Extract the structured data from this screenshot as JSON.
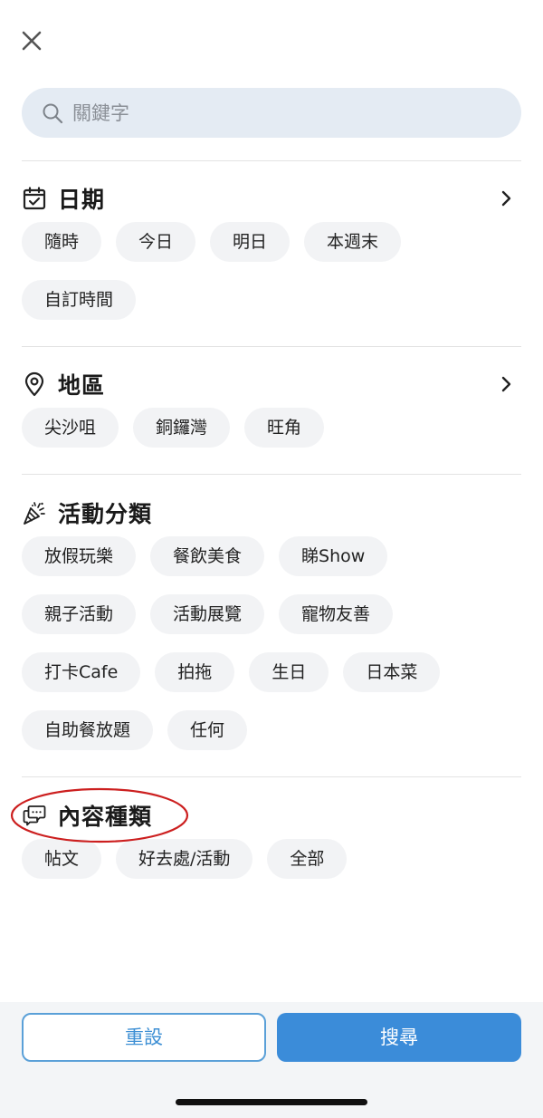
{
  "close": {
    "icon": "close-icon"
  },
  "search": {
    "placeholder": "關鍵字",
    "value": "",
    "icon": "search-icon"
  },
  "sections": {
    "date": {
      "title": "日期",
      "icon": "calendar-check-icon",
      "chips": [
        "隨時",
        "今日",
        "明日",
        "本週末",
        "自訂時間"
      ]
    },
    "area": {
      "title": "地區",
      "icon": "location-pin-icon",
      "chips": [
        "尖沙咀",
        "銅鑼灣",
        "旺角"
      ]
    },
    "category": {
      "title": "活動分類",
      "icon": "party-popper-icon",
      "chips": [
        "放假玩樂",
        "餐飲美食",
        "睇Show",
        "親子活動",
        "活動展覽",
        "寵物友善",
        "打卡Cafe",
        "拍拖",
        "生日",
        "日本菜",
        "自助餐放題",
        "任何"
      ]
    },
    "content_type": {
      "title": "內容種類",
      "icon": "chat-bubbles-icon",
      "chips": [
        "帖文",
        "好去處/活動",
        "全部"
      ]
    }
  },
  "footer": {
    "reset_label": "重設",
    "search_label": "搜尋"
  },
  "colors": {
    "accent": "#3b8cd9",
    "annotation": "#cc1f1f",
    "chip_bg": "#f2f3f5",
    "search_bg": "#e4ebf3"
  }
}
